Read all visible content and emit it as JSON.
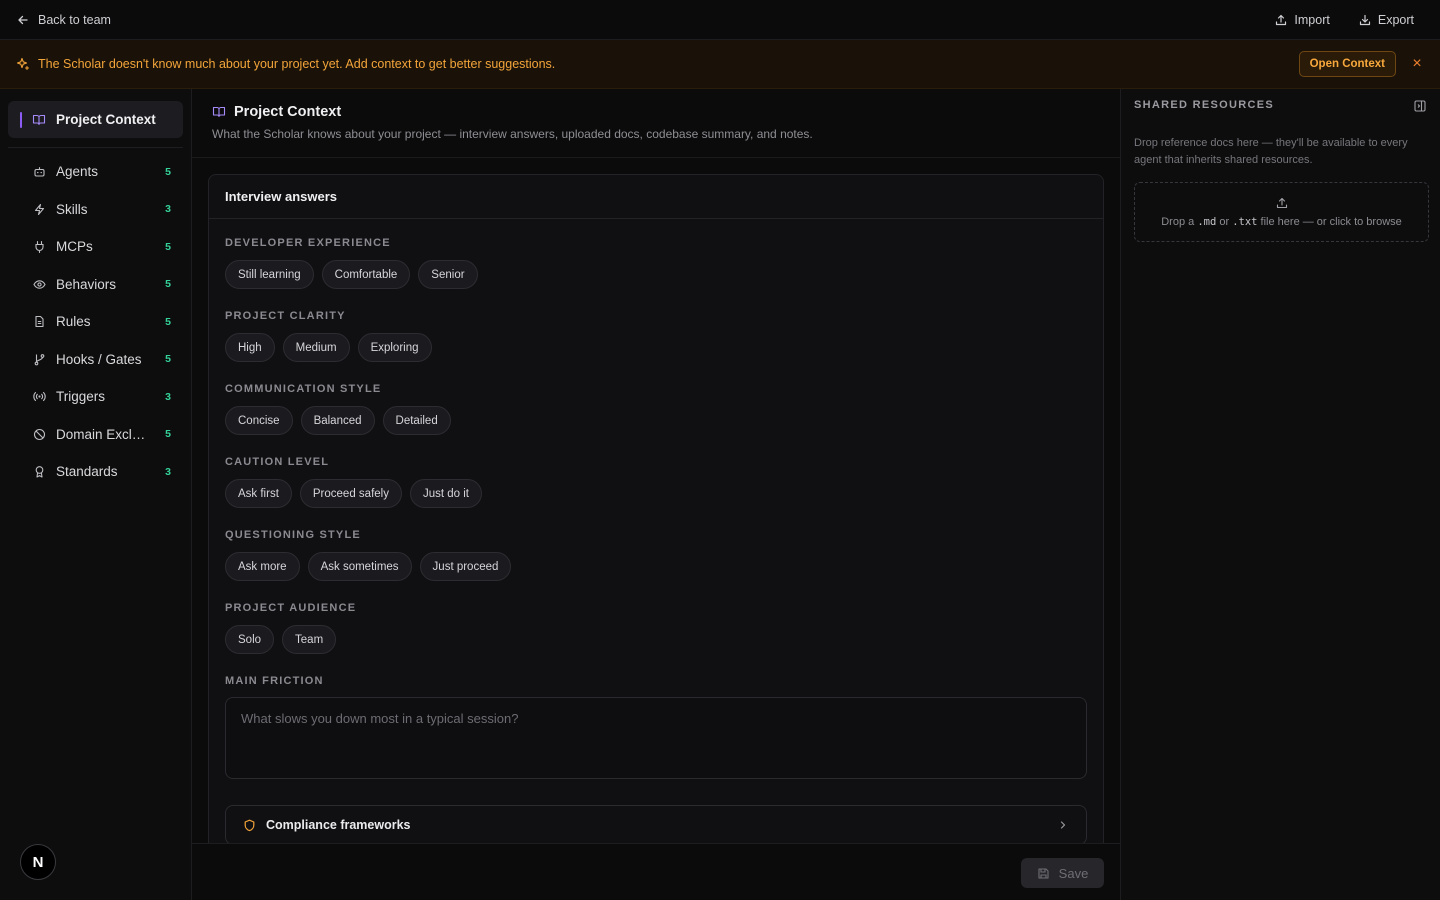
{
  "topbar": {
    "back_label": "Back to team",
    "import_label": "Import",
    "export_label": "Export"
  },
  "banner": {
    "message": "The Scholar doesn't know much about your project yet. Add context to get better suggestions.",
    "action_label": "Open Context",
    "close_glyph": "×"
  },
  "sidebar": {
    "active_label": "Project Context",
    "items": [
      {
        "label": "Agents",
        "count": "5",
        "icon": "bot-icon"
      },
      {
        "label": "Skills",
        "count": "3",
        "icon": "bolt-icon"
      },
      {
        "label": "MCPs",
        "count": "5",
        "icon": "plug-icon"
      },
      {
        "label": "Behaviors",
        "count": "5",
        "icon": "eye-icon"
      },
      {
        "label": "Rules",
        "count": "5",
        "icon": "document-icon"
      },
      {
        "label": "Hooks / Gates",
        "count": "5",
        "icon": "git-branch-icon"
      },
      {
        "label": "Triggers",
        "count": "3",
        "icon": "broadcast-icon"
      },
      {
        "label": "Domain Exclusions",
        "count": "5",
        "icon": "ban-icon"
      },
      {
        "label": "Standards",
        "count": "3",
        "icon": "award-icon"
      }
    ],
    "avatar_letter": "N"
  },
  "main": {
    "title": "Project Context",
    "subtitle": "What the Scholar knows about your project — interview answers, uploaded docs, codebase summary, and notes.",
    "card_title": "Interview answers",
    "sections": [
      {
        "title": "DEVELOPER EXPERIENCE",
        "options": [
          "Still learning",
          "Comfortable",
          "Senior"
        ]
      },
      {
        "title": "PROJECT CLARITY",
        "options": [
          "High",
          "Medium",
          "Exploring"
        ]
      },
      {
        "title": "COMMUNICATION STYLE",
        "options": [
          "Concise",
          "Balanced",
          "Detailed"
        ]
      },
      {
        "title": "CAUTION LEVEL",
        "options": [
          "Ask first",
          "Proceed safely",
          "Just do it"
        ]
      },
      {
        "title": "QUESTIONING STYLE",
        "options": [
          "Ask more",
          "Ask sometimes",
          "Just proceed"
        ]
      },
      {
        "title": "PROJECT AUDIENCE",
        "options": [
          "Solo",
          "Team"
        ]
      }
    ],
    "friction": {
      "title": "MAIN FRICTION",
      "placeholder": "What slows you down most in a typical session?",
      "value": ""
    },
    "compliance_label": "Compliance frameworks",
    "save_label": "Save"
  },
  "right_panel": {
    "title": "SHARED RESOURCES",
    "description": "Drop reference docs here — they'll be available to every agent that inherits shared resources.",
    "drop_prefix": "Drop a",
    "drop_ext_md": ".md",
    "drop_or": "or",
    "drop_ext_txt": ".txt",
    "drop_suffix": "file here — or click to browse"
  },
  "colors": {
    "accent_violet": "#8b5cf6",
    "warning_amber": "#f3a43a",
    "count_green": "#34d399"
  }
}
